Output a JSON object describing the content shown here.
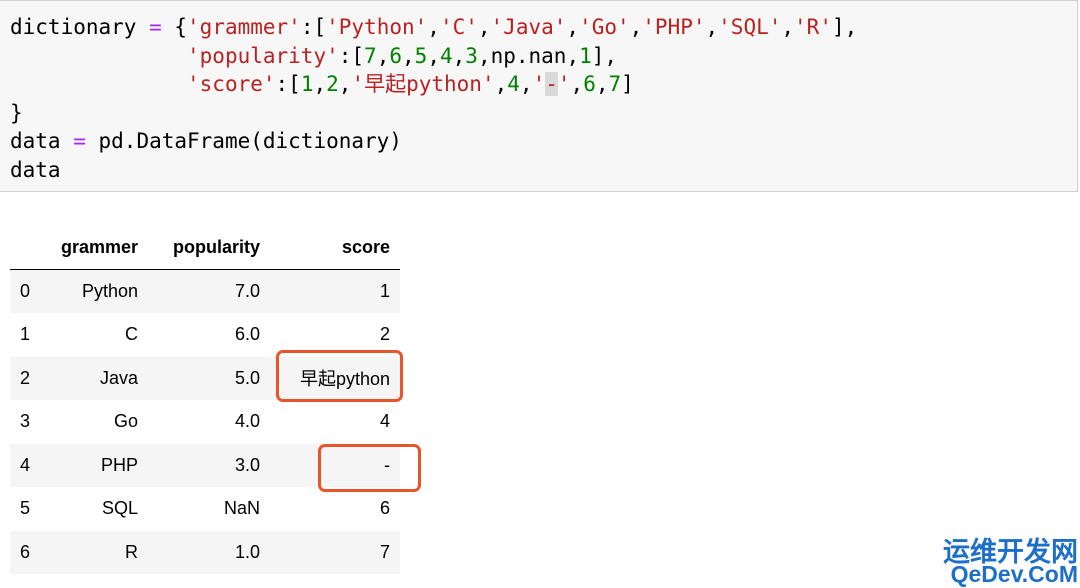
{
  "code": {
    "line1": {
      "var": "dictionary",
      "op": " = ",
      "open": "{",
      "key": "'grammer'",
      "colon": ":[",
      "items": [
        "'Python'",
        "'C'",
        "'Java'",
        "'Go'",
        "'PHP'",
        "'SQL'",
        "'R'"
      ],
      "close": "],"
    },
    "line2": {
      "key": "'popularity'",
      "colon": ":[",
      "nums": [
        "7",
        "6",
        "5",
        "4",
        "3"
      ],
      "nan": "np.nan",
      "last": "1",
      "close": "],"
    },
    "line3": {
      "key": "'score'",
      "colon": ":[",
      "nums": [
        "1",
        "2"
      ],
      "str1": "'早起python'",
      "num4": "4",
      "dash_q1": "'",
      "dash": "-",
      "dash_q2": "'",
      "nums2": [
        "6",
        "7"
      ],
      "close": "]"
    },
    "line4": "}",
    "line5": {
      "var": "data",
      "op": " = ",
      "rest": "pd.DataFrame(dictionary)"
    },
    "line6": "data"
  },
  "table": {
    "headers": [
      "",
      "grammer",
      "popularity",
      "score"
    ],
    "rows": [
      [
        "0",
        "Python",
        "7.0",
        "1"
      ],
      [
        "1",
        "C",
        "6.0",
        "2"
      ],
      [
        "2",
        "Java",
        "5.0",
        "早起python"
      ],
      [
        "3",
        "Go",
        "4.0",
        "4"
      ],
      [
        "4",
        "PHP",
        "3.0",
        "-"
      ],
      [
        "5",
        "SQL",
        "NaN",
        "6"
      ],
      [
        "6",
        "R",
        "1.0",
        "7"
      ]
    ]
  },
  "watermark": {
    "line1": "运维开发网",
    "line2": "QeDev.CoM"
  },
  "colors": {
    "highlight_box": "#e8552a",
    "watermark": "#1e6fc8"
  }
}
